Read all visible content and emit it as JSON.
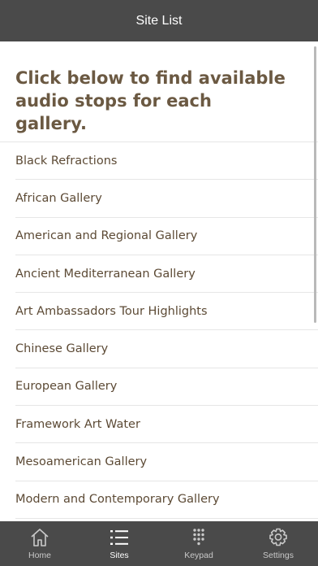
{
  "header": {
    "title": "Site List"
  },
  "intro": {
    "text": "Click below to find available audio stops for each gallery."
  },
  "sites": [
    {
      "label": "Black Refractions"
    },
    {
      "label": "African Gallery"
    },
    {
      "label": "American and Regional Gallery"
    },
    {
      "label": "Ancient Mediterranean Gallery"
    },
    {
      "label": "Art Ambassadors Tour Highlights"
    },
    {
      "label": "Chinese Gallery"
    },
    {
      "label": "European Gallery"
    },
    {
      "label": "Framework Art Water"
    },
    {
      "label": "Mesoamerican Gallery"
    },
    {
      "label": "Modern and Contemporary Gallery"
    }
  ],
  "tabs": [
    {
      "label": "Home",
      "icon": "home-icon"
    },
    {
      "label": "Sites",
      "icon": "list-icon",
      "active": true
    },
    {
      "label": "Keypad",
      "icon": "keypad-icon"
    },
    {
      "label": "Settings",
      "icon": "gear-icon"
    }
  ],
  "colors": {
    "header_bg": "#4a4a4a",
    "accent_text": "#6b5942",
    "list_text": "#5c4a35",
    "tab_inactive": "#c9c9c9",
    "tab_active": "#ffffff"
  }
}
